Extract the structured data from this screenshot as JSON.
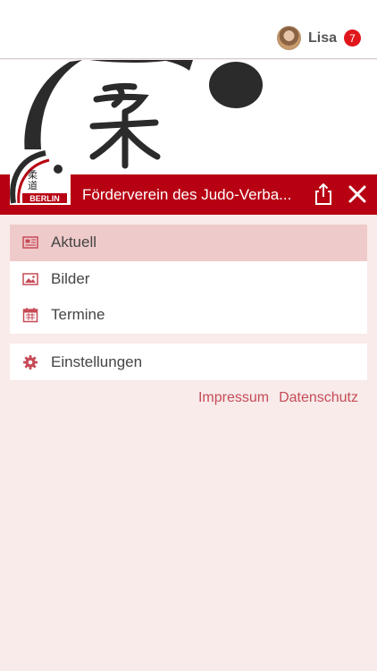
{
  "user": {
    "name": "Lisa",
    "badge_count": "7"
  },
  "header": {
    "title": "Förderverein des Judo-Verba..."
  },
  "logo": {
    "text": "BERLIN"
  },
  "menu": {
    "items": [
      {
        "label": "Aktuell",
        "icon": "newspaper-icon",
        "active": true
      },
      {
        "label": "Bilder",
        "icon": "image-icon",
        "active": false
      },
      {
        "label": "Termine",
        "icon": "calendar-icon",
        "active": false
      }
    ],
    "settings": {
      "label": "Einstellungen",
      "icon": "gear-icon"
    }
  },
  "footer_links": {
    "impressum": "Impressum",
    "datenschutz": "Datenschutz"
  },
  "colors": {
    "brand_red": "#b70012",
    "link": "#c64b57",
    "background": "#f8ebea",
    "active_item": "#efcaca"
  }
}
